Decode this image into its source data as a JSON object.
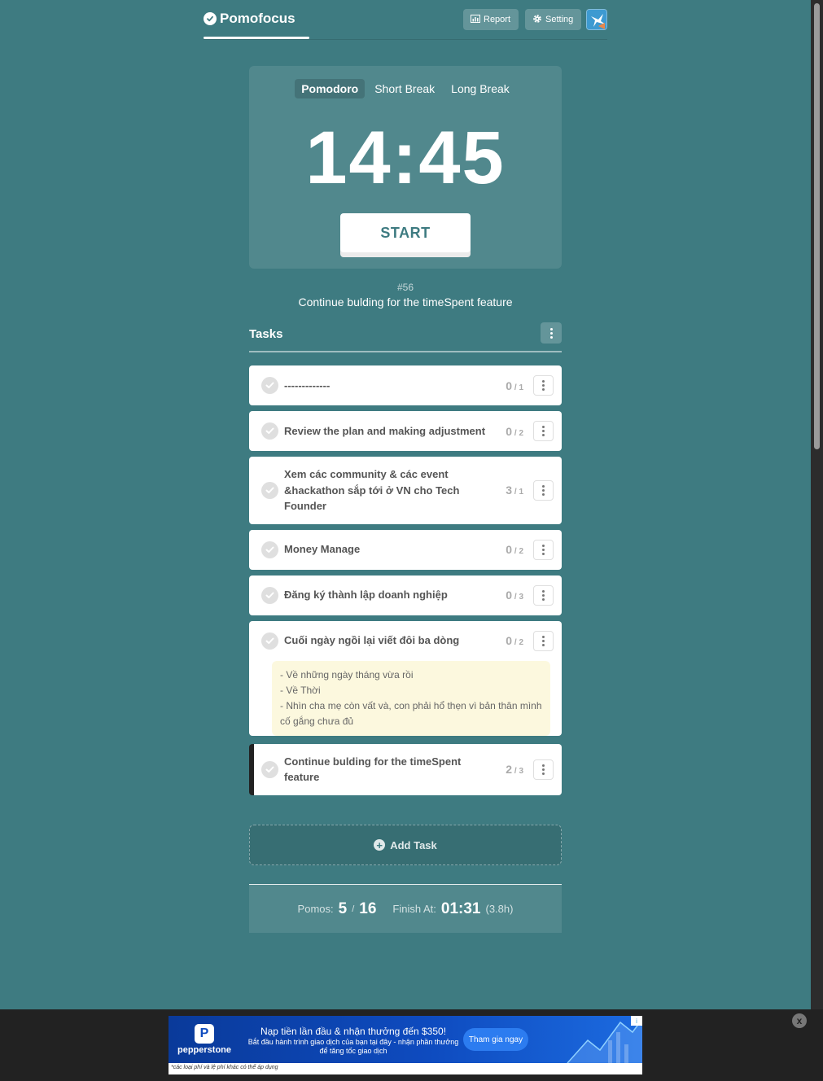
{
  "header": {
    "app_name": "Pomofocus",
    "report_label": "Report",
    "setting_label": "Setting"
  },
  "timer": {
    "tabs": [
      {
        "label": "Pomodoro",
        "active": true
      },
      {
        "label": "Short Break",
        "active": false
      },
      {
        "label": "Long Break",
        "active": false
      }
    ],
    "time": "14:45",
    "start_label": "START"
  },
  "current_task": {
    "number": "#56",
    "title": "Continue bulding for the timeSpent feature"
  },
  "tasks": {
    "title": "Tasks",
    "items": [
      {
        "title": "-------------",
        "done": "0",
        "total": "1",
        "note": "",
        "active": false
      },
      {
        "title": "Review the plan and making adjustment",
        "done": "0",
        "total": "2",
        "note": "",
        "active": false
      },
      {
        "title": "Xem các community & các event &hackathon sắp tới ở VN cho Tech Founder",
        "done": "3",
        "total": "1",
        "note": "",
        "active": false
      },
      {
        "title": "Money Manage",
        "done": "0",
        "total": "2",
        "note": "",
        "active": false
      },
      {
        "title": "Đăng ký thành lập doanh nghiệp",
        "done": "0",
        "total": "3",
        "note": "",
        "active": false
      },
      {
        "title": "Cuối ngày ngồi lại viết đôi ba dòng",
        "done": "0",
        "total": "2",
        "note": "- Về những ngày tháng vừa rồi\n- Về Thời\n- Nhìn cha mẹ còn vất và, con phải hổ thẹn vì bản thân mình cố gắng chưa đủ",
        "active": false
      },
      {
        "title": "Continue bulding for the timeSpent feature",
        "done": "2",
        "total": "3",
        "note": "",
        "active": true
      }
    ],
    "add_label": "Add Task"
  },
  "summary": {
    "pomos_label": "Pomos:",
    "pomos_done": "5",
    "pomos_total": "16",
    "finish_label": "Finish At:",
    "finish_time": "01:31",
    "duration": "(3.8h)"
  },
  "ad": {
    "brand": "pepperstone",
    "headline": "Nạp tiền lần đầu & nhận thưởng đến $350!",
    "subline": "Bắt đầu hành trình giao dịch của bạn tại đây - nhận phần thưởng để tăng tốc giao dịch",
    "cta": "Tham gia ngay",
    "footnote": "*các loại phí và lệ phí khác có thể áp dụng",
    "close": "x"
  },
  "colors": {
    "background": "#3e7b81",
    "accent_text": "#3e7b81",
    "note_background": "#fcf8de"
  }
}
